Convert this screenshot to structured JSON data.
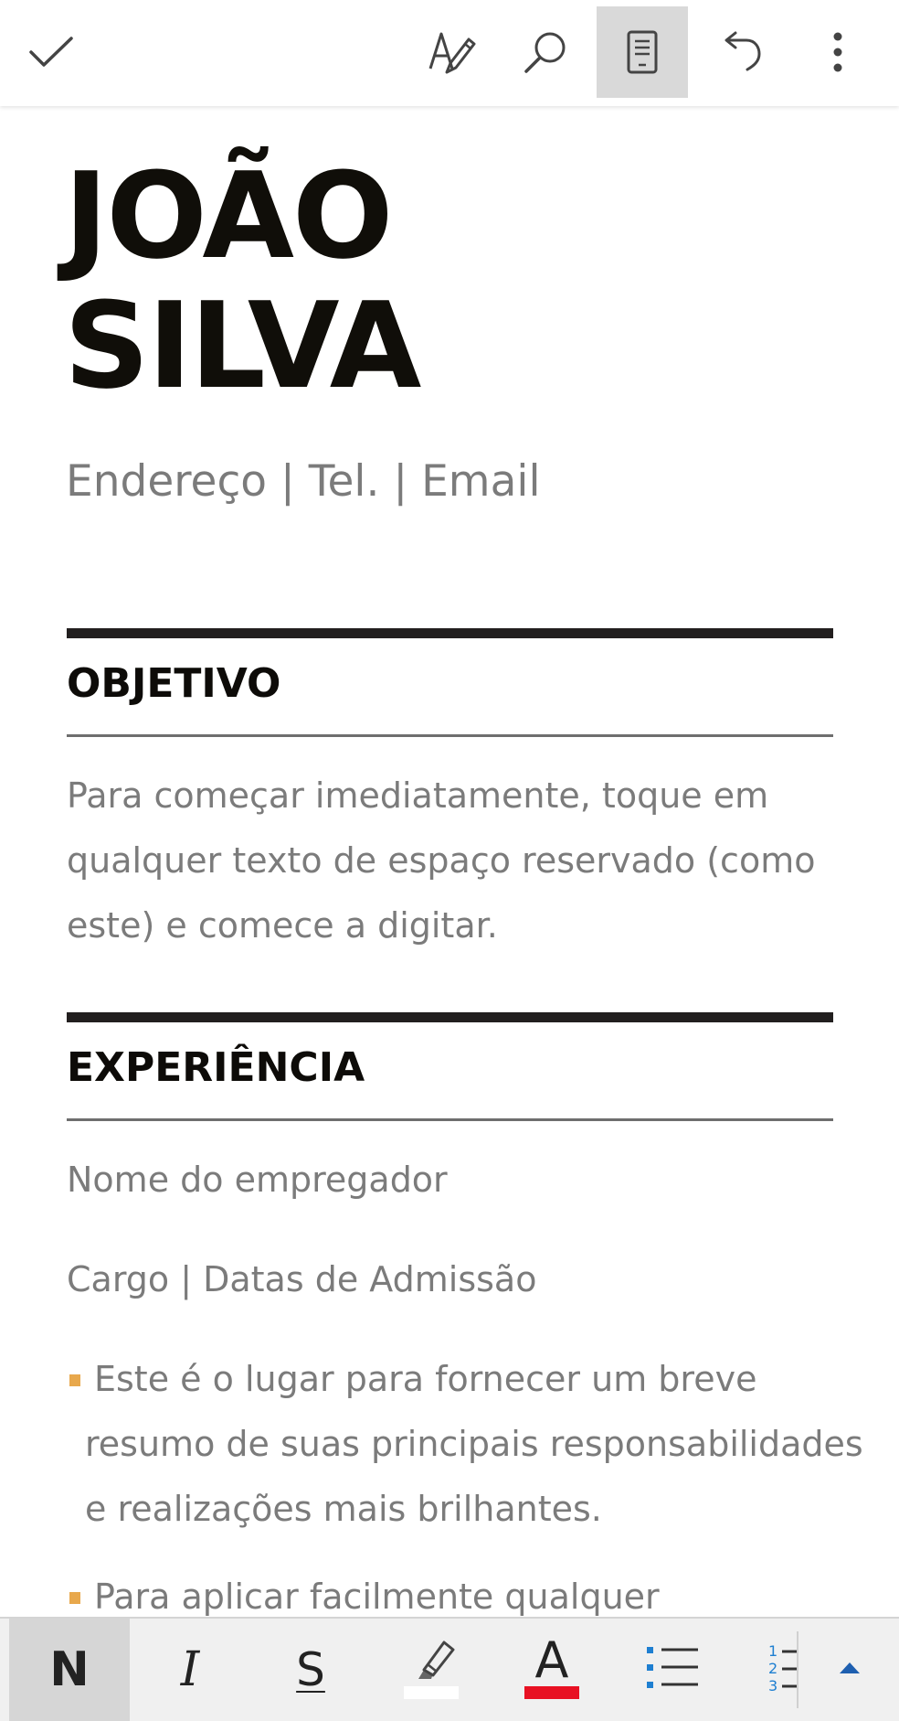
{
  "toolbar": {
    "icons": [
      "checkmark-icon",
      "text-format-icon",
      "search-icon",
      "mobile-view-icon",
      "undo-icon",
      "more-options-icon"
    ],
    "active": "mobile-view-icon"
  },
  "document": {
    "name_line1": "JOÃO",
    "name_line2": "SILVA",
    "contact": "Endereço | Tel. | Email",
    "objective": {
      "heading": "OBJETIVO",
      "lines": [
        "Para começar imediatamente, toque em",
        "qualquer texto de espaço reservado (como",
        "este) e comece a digitar."
      ]
    },
    "experience": {
      "heading": "EXPERIÊNCIA",
      "employer": "Nome do empregador",
      "role": "Cargo | Datas de Admissão",
      "bullets": [
        {
          "lines": [
            "Este é o lugar para fornecer um breve",
            "resumo de suas principais responsabilidades",
            "e realizações mais brilhantes."
          ]
        },
        {
          "lines": [
            "Para aplicar facilmente qualquer"
          ]
        }
      ]
    }
  },
  "format_bar": {
    "bold_label": "N",
    "italic_label": "I",
    "strike_label": "S",
    "font_color_label": "A",
    "colors": {
      "highlight": "#ffffff",
      "font_color": "#e81123",
      "list_accent": "#1e7fd1",
      "bullet_accent": "#e8a84c"
    },
    "numbered_list_digits": [
      "1",
      "2",
      "3"
    ]
  }
}
